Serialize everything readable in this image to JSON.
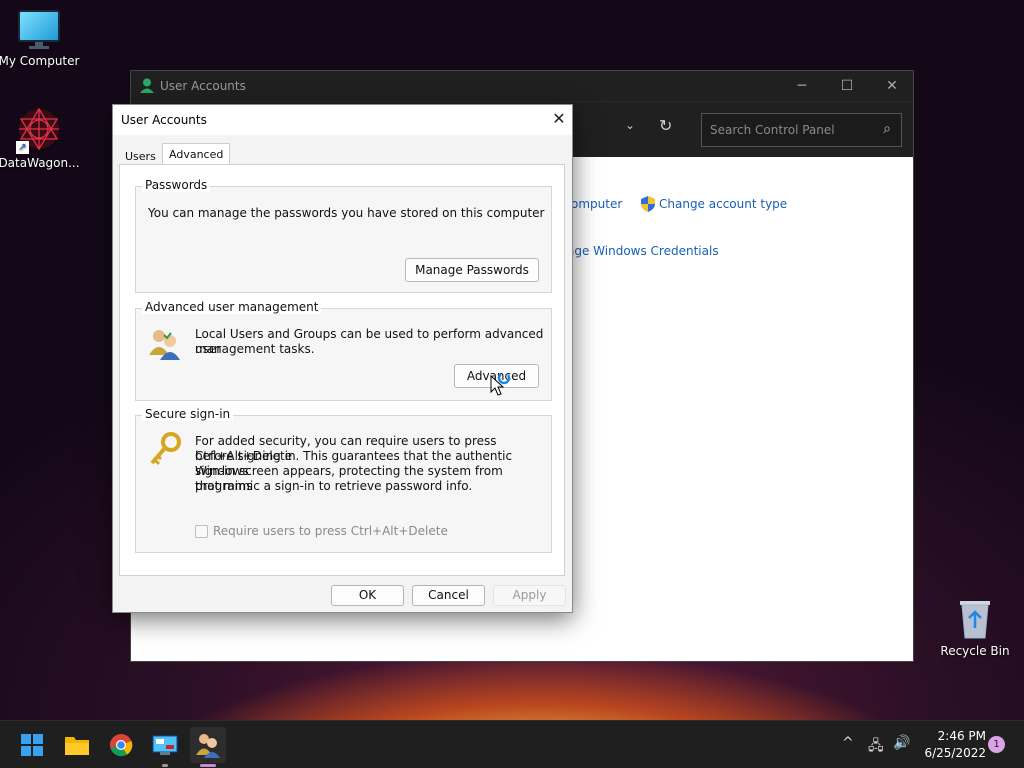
{
  "desktop": {
    "icons": [
      {
        "label": "My Computer",
        "icon": "monitor-icon"
      },
      {
        "label": "DataWagon...",
        "icon": "datawagon-icon"
      },
      {
        "label": "Recycle Bin",
        "icon": "recycle-bin-icon"
      }
    ]
  },
  "control_panel": {
    "title": "User Accounts",
    "search_placeholder": "Search Control Panel",
    "links": {
      "computer": "omputer",
      "change_account_type": "Change account type",
      "credentials": "age Windows Credentials"
    },
    "window_buttons": {
      "minimize": "─",
      "maximize": "☐",
      "close": "✕"
    }
  },
  "dialog": {
    "title": "User Accounts",
    "tabs": [
      {
        "label": "Users",
        "selected": false
      },
      {
        "label": "Advanced",
        "selected": true
      }
    ],
    "passwords": {
      "label": "Passwords",
      "text": "You can manage the passwords you have stored on this computer",
      "button": "Manage Passwords"
    },
    "advanced": {
      "label": "Advanced user management",
      "text_line1": "Local Users and Groups can be used to perform advanced user",
      "text_line2": "management tasks.",
      "button": "Advanced"
    },
    "secure": {
      "label": "Secure sign-in",
      "text_lines": [
        "For added security, you can require users to press Ctrl+Alt+Delete",
        "before signing in. This guarantees that the authentic Windows",
        "sign-in screen appears, protecting the system from programs",
        "that mimic a sign-in to retrieve password info."
      ],
      "checkbox_label": "Require users to press Ctrl+Alt+Delete",
      "checked": false,
      "enabled": false
    },
    "buttons": {
      "ok": "OK",
      "cancel": "Cancel",
      "apply": "Apply"
    }
  },
  "taskbar": {
    "apps": [
      "start-icon",
      "file-explorer-icon",
      "chrome-icon",
      "control-panel-icon",
      "user-accounts-icon"
    ],
    "tray": {
      "up": "^",
      "network": "🖧",
      "volume": "🔊"
    },
    "time": "2:46 PM",
    "date": "6/25/2022",
    "notifications": "1"
  }
}
